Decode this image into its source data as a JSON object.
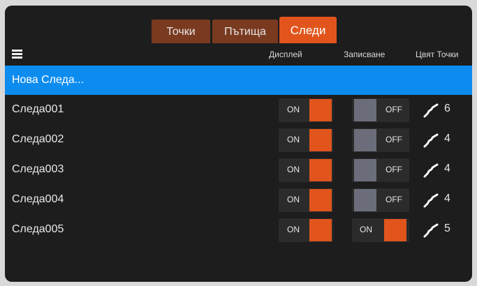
{
  "tabs": [
    {
      "label": "Точки",
      "active": false
    },
    {
      "label": "Пътища",
      "active": false
    },
    {
      "label": "Следи",
      "active": true
    }
  ],
  "columns": {
    "display": "Дисплей",
    "recording": "Записване",
    "color_points": "Цвят Точки"
  },
  "new_track_label": "Нова Следа...",
  "rows": [
    {
      "name": "Следа001",
      "display": "ON",
      "recording": "OFF",
      "color_points": "6"
    },
    {
      "name": "Следа002",
      "display": "ON",
      "recording": "OFF",
      "color_points": "4"
    },
    {
      "name": "Следа003",
      "display": "ON",
      "recording": "OFF",
      "color_points": "4"
    },
    {
      "name": "Следа004",
      "display": "ON",
      "recording": "OFF",
      "color_points": "4"
    },
    {
      "name": "Следа005",
      "display": "ON",
      "recording": "ON",
      "color_points": "5"
    }
  ],
  "colors": {
    "accent": "#e1551c",
    "tab_inactive": "#7a3a20",
    "selection": "#0d8cf0",
    "switch_off": "#6b6e7a",
    "background": "#1d1d1d"
  },
  "icons": {
    "menu": "hamburger-menu-icon",
    "track": "track-squiggle-icon"
  }
}
